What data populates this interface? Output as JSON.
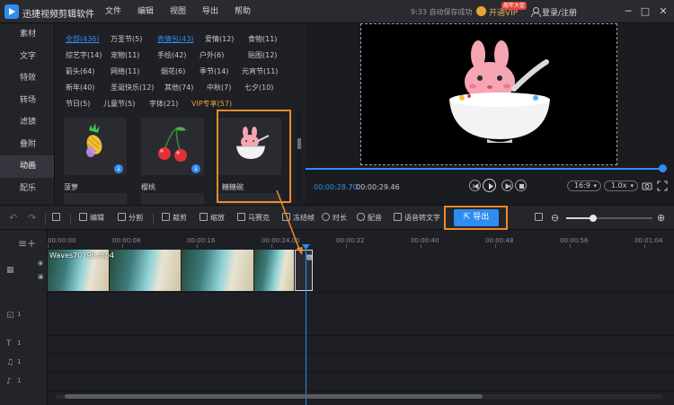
{
  "app": {
    "title": "迅捷视频剪辑软件",
    "save_status": "9:33 自动保存成功",
    "vip_label": "开通VIP",
    "vip_badge": "周年大促",
    "login_label": "登录/注册"
  },
  "menu": [
    "文件",
    "编辑",
    "视图",
    "导出",
    "帮助"
  ],
  "window_controls": [
    "─",
    "□",
    "✕"
  ],
  "left_nav": {
    "items": [
      "素材",
      "文字",
      "特效",
      "转场",
      "滤镜",
      "叠附",
      "动画",
      "配乐"
    ],
    "active_index": 6
  },
  "sticker_panel": {
    "tag_rows": [
      [
        "全部(436)",
        "万圣节(5)",
        "表情包(43)",
        "爱情(12)",
        "食物(11)"
      ],
      [
        "综艺字(14)",
        "宠物(11)",
        "手绘(42)",
        "户外(6)",
        "贴图(12)"
      ],
      [
        "箭头(64)",
        "网络(11)",
        "烟花(6)",
        "季节(14)",
        "元宵节(11)"
      ],
      [
        "新年(40)",
        "圣诞快乐(12)",
        "其他(74)",
        "中秋(7)",
        "七夕(10)"
      ],
      [
        "节日(5)",
        "儿童节(5)",
        "字体(21)",
        "VIP专享(57)"
      ]
    ],
    "active_tags": [
      "全部(436)",
      "表情包(43)"
    ],
    "vip_tag": "VIP专享(57)",
    "stickers": [
      {
        "name": "菠萝",
        "icon": "pineapple-icon",
        "downloadable": true
      },
      {
        "name": "樱桃",
        "icon": "cherry-icon",
        "downloadable": true
      },
      {
        "name": "糖糖碗",
        "icon": "bunny-bowl-icon",
        "downloadable": false
      }
    ]
  },
  "preview": {
    "current_time": "00:00:28.70",
    "separator": "/",
    "total_time": "00:00:29.46",
    "aspect_ratio": "16:9",
    "speed": "1.0x",
    "progress": 0.974
  },
  "toolbar": {
    "undo": "↶",
    "redo": "↷",
    "edit": "编辑",
    "split": "分割",
    "crop": "裁剪",
    "zoom": "缩放",
    "mosaic": "马赛克",
    "freeze": "冻结帧",
    "duration": "时长",
    "dub": "配音",
    "speech_to_text": "语音转文字",
    "export": "导出",
    "zoom_level": 0.3
  },
  "timeline": {
    "ticks": [
      "00:00:00",
      "00:00:08",
      "00:00:16",
      "00:00:24.00",
      "00:00:32",
      "00:00:40",
      "00:00:48",
      "00:00:56",
      "00:01:04"
    ],
    "video_clip_name": "Waves70796.mp4",
    "sticker_clip_name": "糖",
    "track_numbers": [
      "1",
      "1",
      "1",
      "1"
    ],
    "accent": "#2f8cf0",
    "highlight": "#ee8a2a"
  }
}
